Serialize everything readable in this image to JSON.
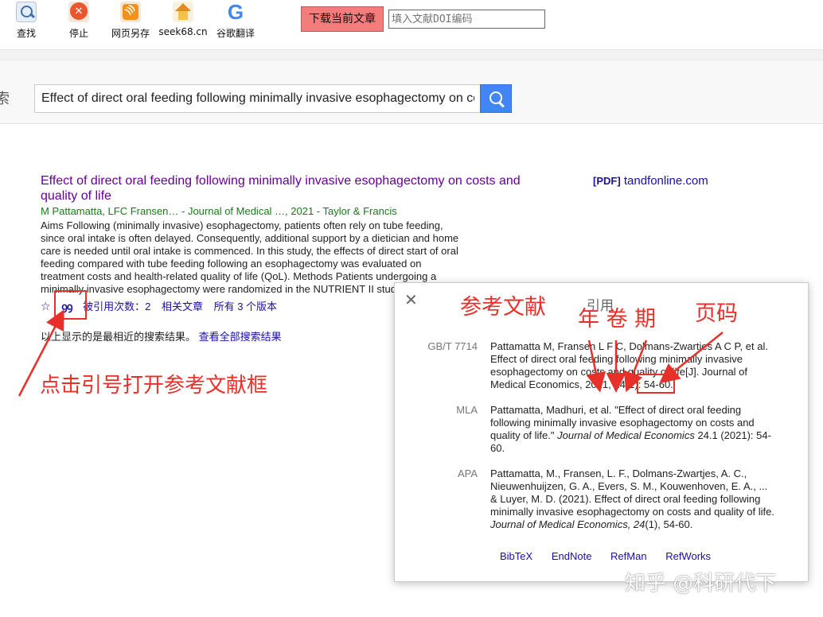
{
  "toolbar": {
    "buttons": [
      {
        "label": "查找",
        "icon": "search-icon"
      },
      {
        "label": "停止",
        "icon": "stop-icon"
      },
      {
        "label": "网页另存",
        "icon": "rss-save-icon"
      },
      {
        "label": "seek68.cn",
        "icon": "home-icon"
      },
      {
        "label": "谷歌翻译",
        "icon": "google-icon"
      }
    ],
    "download_label": "下载当前文章",
    "doi_placeholder": "填入文献DOI编码",
    "google_glyph": "G"
  },
  "search": {
    "edge_char": "索",
    "query": "Effect of direct oral feeding following minimally invasive esophagectomy on costs and quality of life"
  },
  "result": {
    "title": "Effect of direct oral feeding following minimally invasive esophagectomy on costs and quality of life",
    "authors": "M Pattamatta, LFC Fransen… - Journal of Medical …, 2021 - Taylor & Francis",
    "snippet": [
      "Aims Following (minimally invasive) esophagectomy, patients often rely on tube feeding,",
      "since oral intake is often delayed. Consequently, additional support by a dietician and home",
      "care is needed until oral intake is commenced. In this study, the effects of direct start of oral",
      "feeding compared with tube feeding following an esophagectomy was evaluated on",
      "treatment costs and health-related quality of life (QoL). Methods Patients undergoing a",
      "minimally invasive esophagectomy were randomized in the NUTRIENT II study"
    ],
    "star": "☆",
    "quote": "ꝯꝯ",
    "cited_by": "被引用次数：2",
    "related": "相关文章",
    "versions": "所有 3 个版本",
    "info_text": "以上显示的是最相近的搜索结果。",
    "info_link": "查看全部搜索结果",
    "pdf_tag": "[PDF]",
    "pdf_source": "tandfonline.com"
  },
  "dialog": {
    "close": "✕",
    "title": "引用",
    "citations": [
      {
        "format": "GB/T 7714",
        "lines": [
          "Pattamatta M, Fransen L F C, Dolmans-Zwartjes A C P, et al.",
          "Effect of direct oral feeding following minimally invasive",
          "esophagectomy on costs and quality of life[J]. Journal of",
          "Medical Economics, 2021, 24(1): 54-60."
        ]
      },
      {
        "format": "MLA",
        "lines": [
          "Pattamatta, Madhuri, et al. \"Effect of direct oral feeding",
          "following minimally invasive esophagectomy on costs and",
          "quality of life.\"",
          "Journal of Medical Economics",
          " 24.1 (2021): 54-",
          "60."
        ]
      },
      {
        "format": "APA",
        "lines": [
          "Pattamatta, M., Fransen, L. F., Dolmans-Zwartjes, A. C.,",
          "Nieuwenhuijzen, G. A., Evers, S. M., Kouwenhoven, E. A., ...",
          "& Luyer, M. D. (2021). Effect of direct oral feeding following",
          "minimally invasive esophagectomy on costs and quality of life.",
          "Journal of Medical Economics, 24",
          "(1), 54-60."
        ]
      }
    ],
    "exports": [
      "BibTeX",
      "EndNote",
      "RefMan",
      "RefWorks"
    ]
  },
  "annotations": {
    "click_hint": "点击引号打开参考文献框",
    "references": "参考文献",
    "year_vol_issue": "年 卷  期",
    "pages": "页码",
    "color": "#e8302b"
  },
  "watermark": "知乎 @科研代下"
}
